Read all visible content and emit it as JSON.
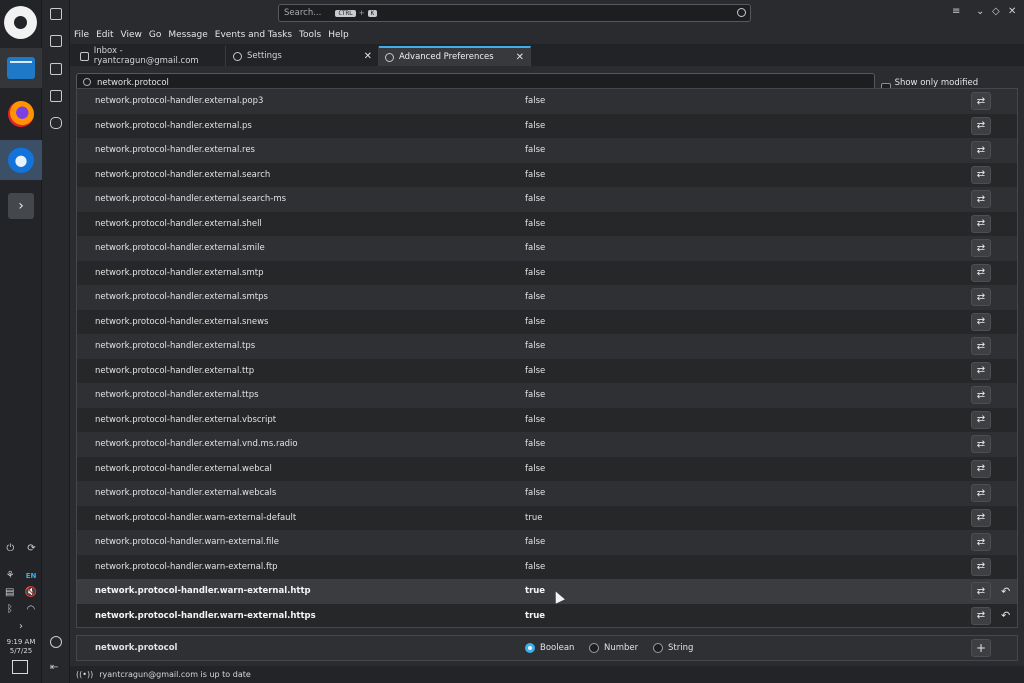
{
  "taskbar": {
    "language": "EN",
    "time": "9:19 AM",
    "date": "5/7/25"
  },
  "search": {
    "placeholder": "Search...",
    "key1": "CTRL",
    "plus": "+",
    "key2": "K"
  },
  "menu": [
    "File",
    "Edit",
    "View",
    "Go",
    "Message",
    "Events and Tasks",
    "Tools",
    "Help"
  ],
  "tabs": [
    {
      "label": "Inbox - ryantcragun@gmail.com"
    },
    {
      "label": "Settings"
    },
    {
      "label": "Advanced Preferences"
    }
  ],
  "filter": {
    "value": "network.protocol",
    "show_modified_label": "Show only modified preferences"
  },
  "prefs": [
    {
      "name": "network.protocol-handler.external.pop3",
      "value": "false"
    },
    {
      "name": "network.protocol-handler.external.ps",
      "value": "false"
    },
    {
      "name": "network.protocol-handler.external.res",
      "value": "false"
    },
    {
      "name": "network.protocol-handler.external.search",
      "value": "false"
    },
    {
      "name": "network.protocol-handler.external.search-ms",
      "value": "false"
    },
    {
      "name": "network.protocol-handler.external.shell",
      "value": "false"
    },
    {
      "name": "network.protocol-handler.external.smile",
      "value": "false"
    },
    {
      "name": "network.protocol-handler.external.smtp",
      "value": "false"
    },
    {
      "name": "network.protocol-handler.external.smtps",
      "value": "false"
    },
    {
      "name": "network.protocol-handler.external.snews",
      "value": "false"
    },
    {
      "name": "network.protocol-handler.external.tps",
      "value": "false"
    },
    {
      "name": "network.protocol-handler.external.ttp",
      "value": "false"
    },
    {
      "name": "network.protocol-handler.external.ttps",
      "value": "false"
    },
    {
      "name": "network.protocol-handler.external.vbscript",
      "value": "false"
    },
    {
      "name": "network.protocol-handler.external.vnd.ms.radio",
      "value": "false"
    },
    {
      "name": "network.protocol-handler.external.webcal",
      "value": "false"
    },
    {
      "name": "network.protocol-handler.external.webcals",
      "value": "false"
    },
    {
      "name": "network.protocol-handler.warn-external-default",
      "value": "true"
    },
    {
      "name": "network.protocol-handler.warn-external.file",
      "value": "false"
    },
    {
      "name": "network.protocol-handler.warn-external.ftp",
      "value": "false"
    },
    {
      "name": "network.protocol-handler.warn-external.http",
      "value": "true",
      "modified": true
    },
    {
      "name": "network.protocol-handler.warn-external.https",
      "value": "true",
      "modified": true
    }
  ],
  "add_pref": {
    "name": "network.protocol",
    "types": [
      "Boolean",
      "Number",
      "String"
    ],
    "selected": "Boolean"
  },
  "status": {
    "text": "ryantcragun@gmail.com is up to date"
  },
  "colors": {
    "accent": "#3daee9"
  }
}
